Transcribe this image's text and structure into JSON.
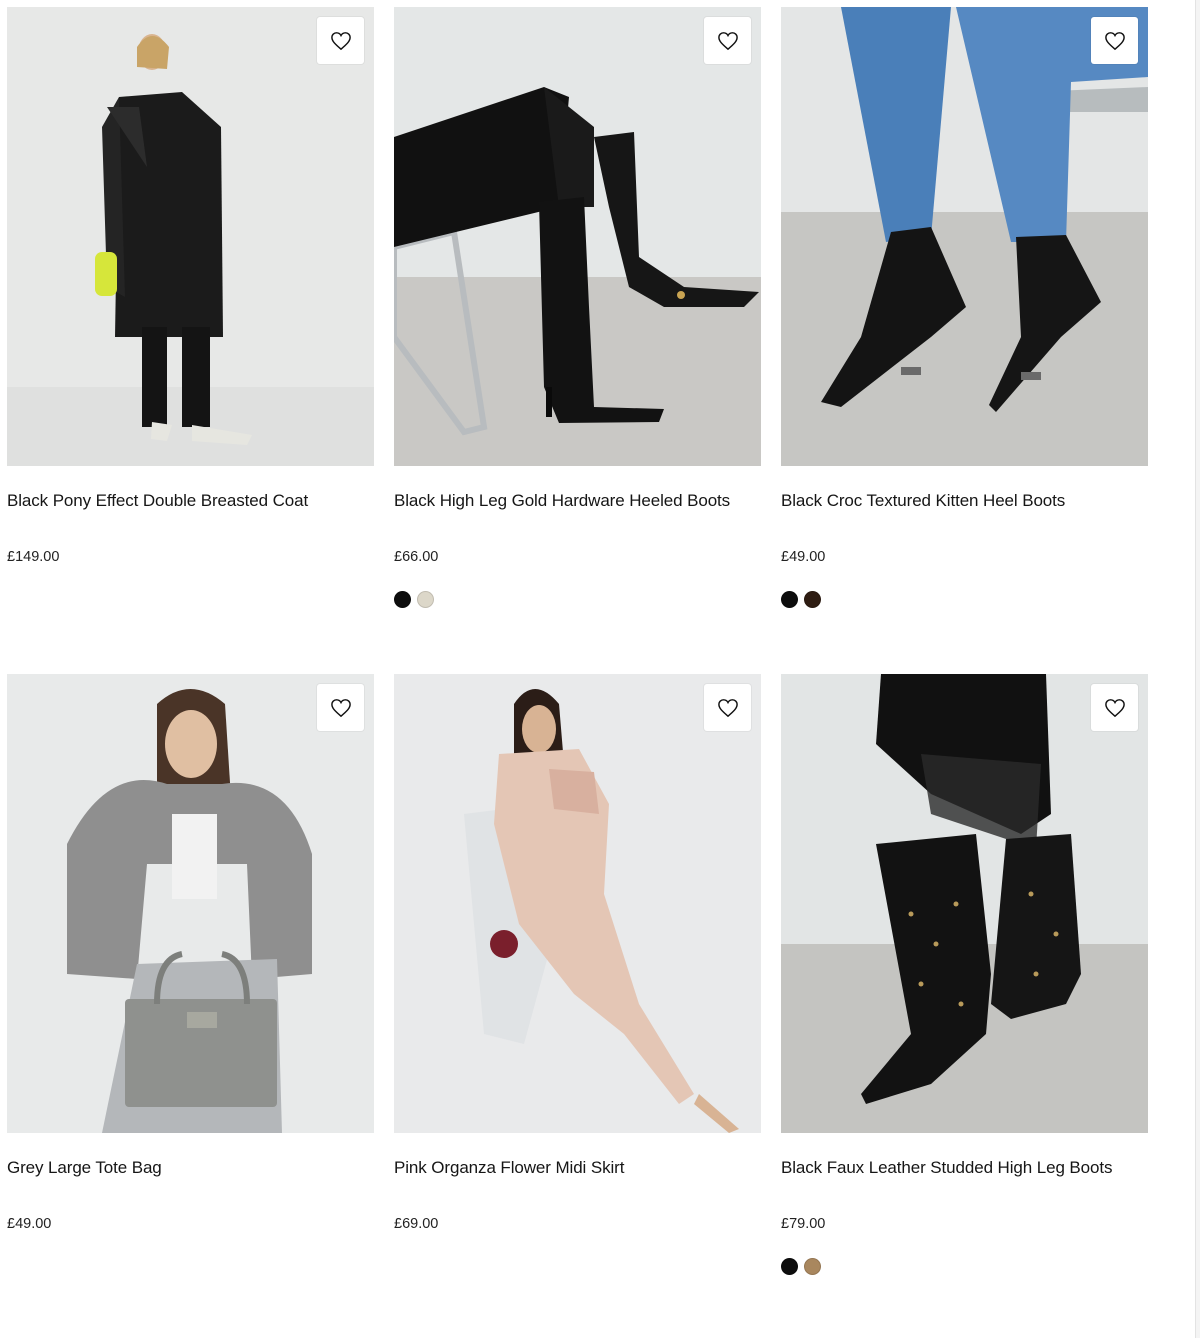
{
  "products": [
    {
      "name": "Black Pony Effect Double Breasted Coat",
      "price": "£149.00",
      "swatches": [],
      "wishlist_icon": "heart-outline-icon",
      "image_bg": "#e6e7e6"
    },
    {
      "name": "Black High Leg Gold Hardware Heeled Boots",
      "price": "£66.00",
      "swatches": [
        "#0d0d0d",
        "#dcd7c9"
      ],
      "wishlist_icon": "heart-outline-icon",
      "image_bg": "#e3e6e6"
    },
    {
      "name": "Black Croc Textured Kitten Heel Boots",
      "price": "£49.00",
      "swatches": [
        "#0d0d0d",
        "#2e1c12"
      ],
      "wishlist_icon": "heart-outline-icon",
      "image_bg": "#dcdfdf"
    },
    {
      "name": "Grey Large Tote Bag",
      "price": "£49.00",
      "swatches": [],
      "wishlist_icon": "heart-outline-icon",
      "image_bg": "#e7e9e9"
    },
    {
      "name": "Pink Organza Flower Midi Skirt",
      "price": "£69.00",
      "swatches": [],
      "wishlist_icon": "heart-outline-icon",
      "image_bg": "#e8e9ea"
    },
    {
      "name": "Black Faux Leather Studded High Leg Boots",
      "price": "£79.00",
      "swatches": [
        "#0d0d0d",
        "#a9875e"
      ],
      "wishlist_icon": "heart-outline-icon",
      "image_bg": "#dfe2e2"
    }
  ]
}
